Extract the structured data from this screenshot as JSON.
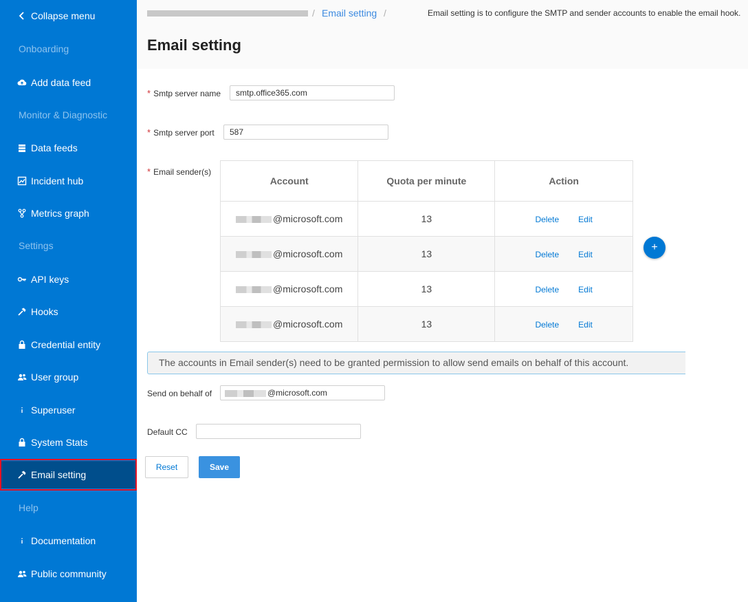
{
  "sidebar": {
    "collapse_label": "Collapse menu",
    "groups": {
      "onboarding": "Onboarding",
      "monitor": "Monitor & Diagnostic",
      "settings": "Settings",
      "help": "Help"
    },
    "items": {
      "add_data_feed": "Add data feed",
      "data_feeds": "Data feeds",
      "incident_hub": "Incident hub",
      "metrics_graph": "Metrics graph",
      "api_keys": "API keys",
      "hooks": "Hooks",
      "credential_entity": "Credential entity",
      "user_group": "User group",
      "superuser": "Superuser",
      "system_stats": "System Stats",
      "email_setting": "Email setting",
      "documentation": "Documentation",
      "public_community": "Public community"
    }
  },
  "header": {
    "breadcrumb_sep": "/",
    "breadcrumb_current": "Email setting",
    "description": "Email setting is to configure the SMTP and sender accounts to enable the email hook.",
    "title": "Email setting"
  },
  "form": {
    "required_mark": "*",
    "smtp_name_label": "Smtp server name",
    "smtp_name_value": "smtp.office365.com",
    "smtp_port_label": "Smtp server port",
    "smtp_port_value": "587",
    "senders_label": "Email sender(s)",
    "table": {
      "headers": [
        "Account",
        "Quota per minute",
        "Action"
      ],
      "rows": [
        {
          "account": "@microsoft.com",
          "quota": "13"
        },
        {
          "account": "@microsoft.com",
          "quota": "13"
        },
        {
          "account": "@microsoft.com",
          "quota": "13"
        },
        {
          "account": "@microsoft.com",
          "quota": "13"
        }
      ],
      "delete_label": "Delete",
      "edit_label": "Edit"
    },
    "add_label": "+",
    "info_text": "The accounts in Email sender(s) need to be granted permission to allow send emails on behalf of this account.",
    "behalf_label": "Send on behalf of",
    "behalf_value": "@microsoft.com",
    "cc_label": "Default CC",
    "cc_value": "",
    "reset_label": "Reset",
    "save_label": "Save"
  },
  "colors": {
    "sidebar": "#0078d4",
    "sidebar_active": "#004e8c",
    "accent": "#0078d4",
    "highlight_border": "#e81123"
  }
}
